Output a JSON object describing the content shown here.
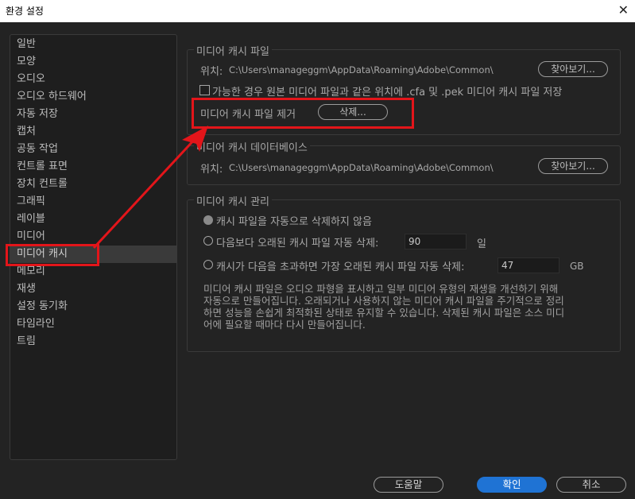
{
  "window": {
    "title": "환경 설정",
    "close_glyph": "✕"
  },
  "sidebar": {
    "items": [
      {
        "label": "일반"
      },
      {
        "label": "모양"
      },
      {
        "label": "오디오"
      },
      {
        "label": "오디오 하드웨어"
      },
      {
        "label": "자동 저장"
      },
      {
        "label": "캡처"
      },
      {
        "label": "공동 작업"
      },
      {
        "label": "컨트롤 표면"
      },
      {
        "label": "장치 컨트롤"
      },
      {
        "label": "그래픽"
      },
      {
        "label": "레이블"
      },
      {
        "label": "미디어"
      },
      {
        "label": "미디어 캐시"
      },
      {
        "label": "메모리"
      },
      {
        "label": "재생"
      },
      {
        "label": "설정 동기화"
      },
      {
        "label": "타임라인"
      },
      {
        "label": "트림"
      }
    ],
    "selected": "미디어 캐시"
  },
  "cache_files": {
    "title": "미디어 캐시 파일",
    "location_label": "위치:",
    "location_path": "C:\\Users\\manageggm\\AppData\\Roaming\\Adobe\\Common\\",
    "browse_label": "찾아보기...",
    "save_next_label": "가능한 경우 원본 미디어 파일과 같은 위치에 .cfa 및 .pek 미디어 캐시 파일 저장",
    "remove_label": "미디어 캐시 파일 제거",
    "delete_label": "삭제..."
  },
  "cache_db": {
    "title": "미디어 캐시 데이터베이스",
    "location_label": "위치:",
    "location_path": "C:\\Users\\manageggm\\AppData\\Roaming\\Adobe\\Common\\",
    "browse_label": "찾아보기..."
  },
  "cache_mgmt": {
    "title": "미디어 캐시 관리",
    "opt_never": "캐시 파일을 자동으로 삭제하지 않음",
    "opt_older": "다음보다 오래된 캐시 파일 자동 삭제:",
    "older_value": "90",
    "older_unit": "일",
    "opt_exceed": "캐시가 다음을 초과하면 가장 오래된 캐시 파일 자동 삭제:",
    "exceed_value": "47",
    "exceed_unit": "GB",
    "description": "미디어 캐시 파일은 오디오 파형을 표시하고 일부 미디어 유형의 재생을 개선하기 위해 자동으로 만들어집니다. 오래되거나 사용하지 않는 미디어 캐시 파일을 주기적으로 정리하면 성능을 손쉽게 최적화된 상태로 유지할 수 있습니다. 삭제된 캐시 파일은 소스 미디어에 필요할 때마다 다시 만들어집니다."
  },
  "footer": {
    "help_label": "도움말",
    "ok_label": "확인",
    "cancel_label": "취소"
  },
  "annotation": {
    "color": "#e3151a"
  }
}
